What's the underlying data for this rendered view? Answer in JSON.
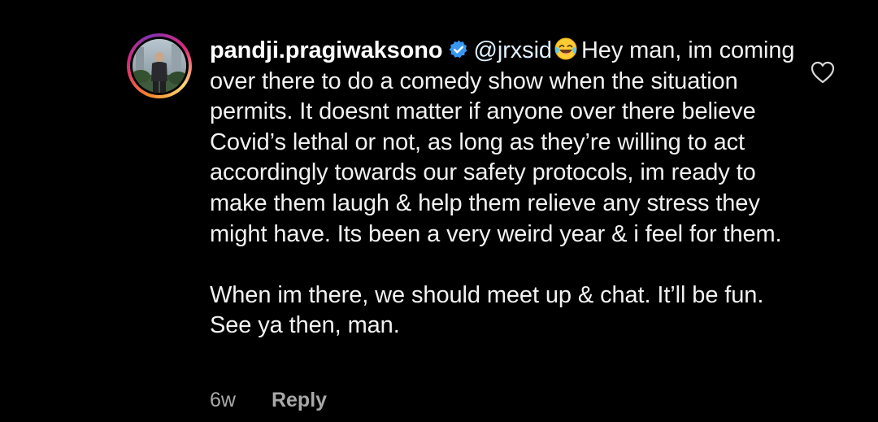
{
  "comment": {
    "username": "pandji.pragiwaksono",
    "verified_icon": "verified-badge-icon",
    "mention": "@jrxsid",
    "emoji": "tears-of-joy-emoji",
    "paragraph_1": "Hey man, im coming over there to do a comedy show when the situation permits. It doesnt matter if anyone over there believe Covid’s lethal or not, as long as they’re willing to act accordingly towards our safety protocols, im ready to make them laugh & help them relieve any stress they might have. Its been a very weird year & i feel for them.",
    "paragraph_2": "When im there, we should meet up & chat. It’ll be fun. See ya then, man.",
    "time_ago": "6w",
    "reply_label": "Reply",
    "like_icon": "heart-outline-icon"
  },
  "colors": {
    "background": "#000000",
    "text": "#f2f2f2",
    "meta": "#a8a8a8",
    "verified": "#3897f0"
  }
}
